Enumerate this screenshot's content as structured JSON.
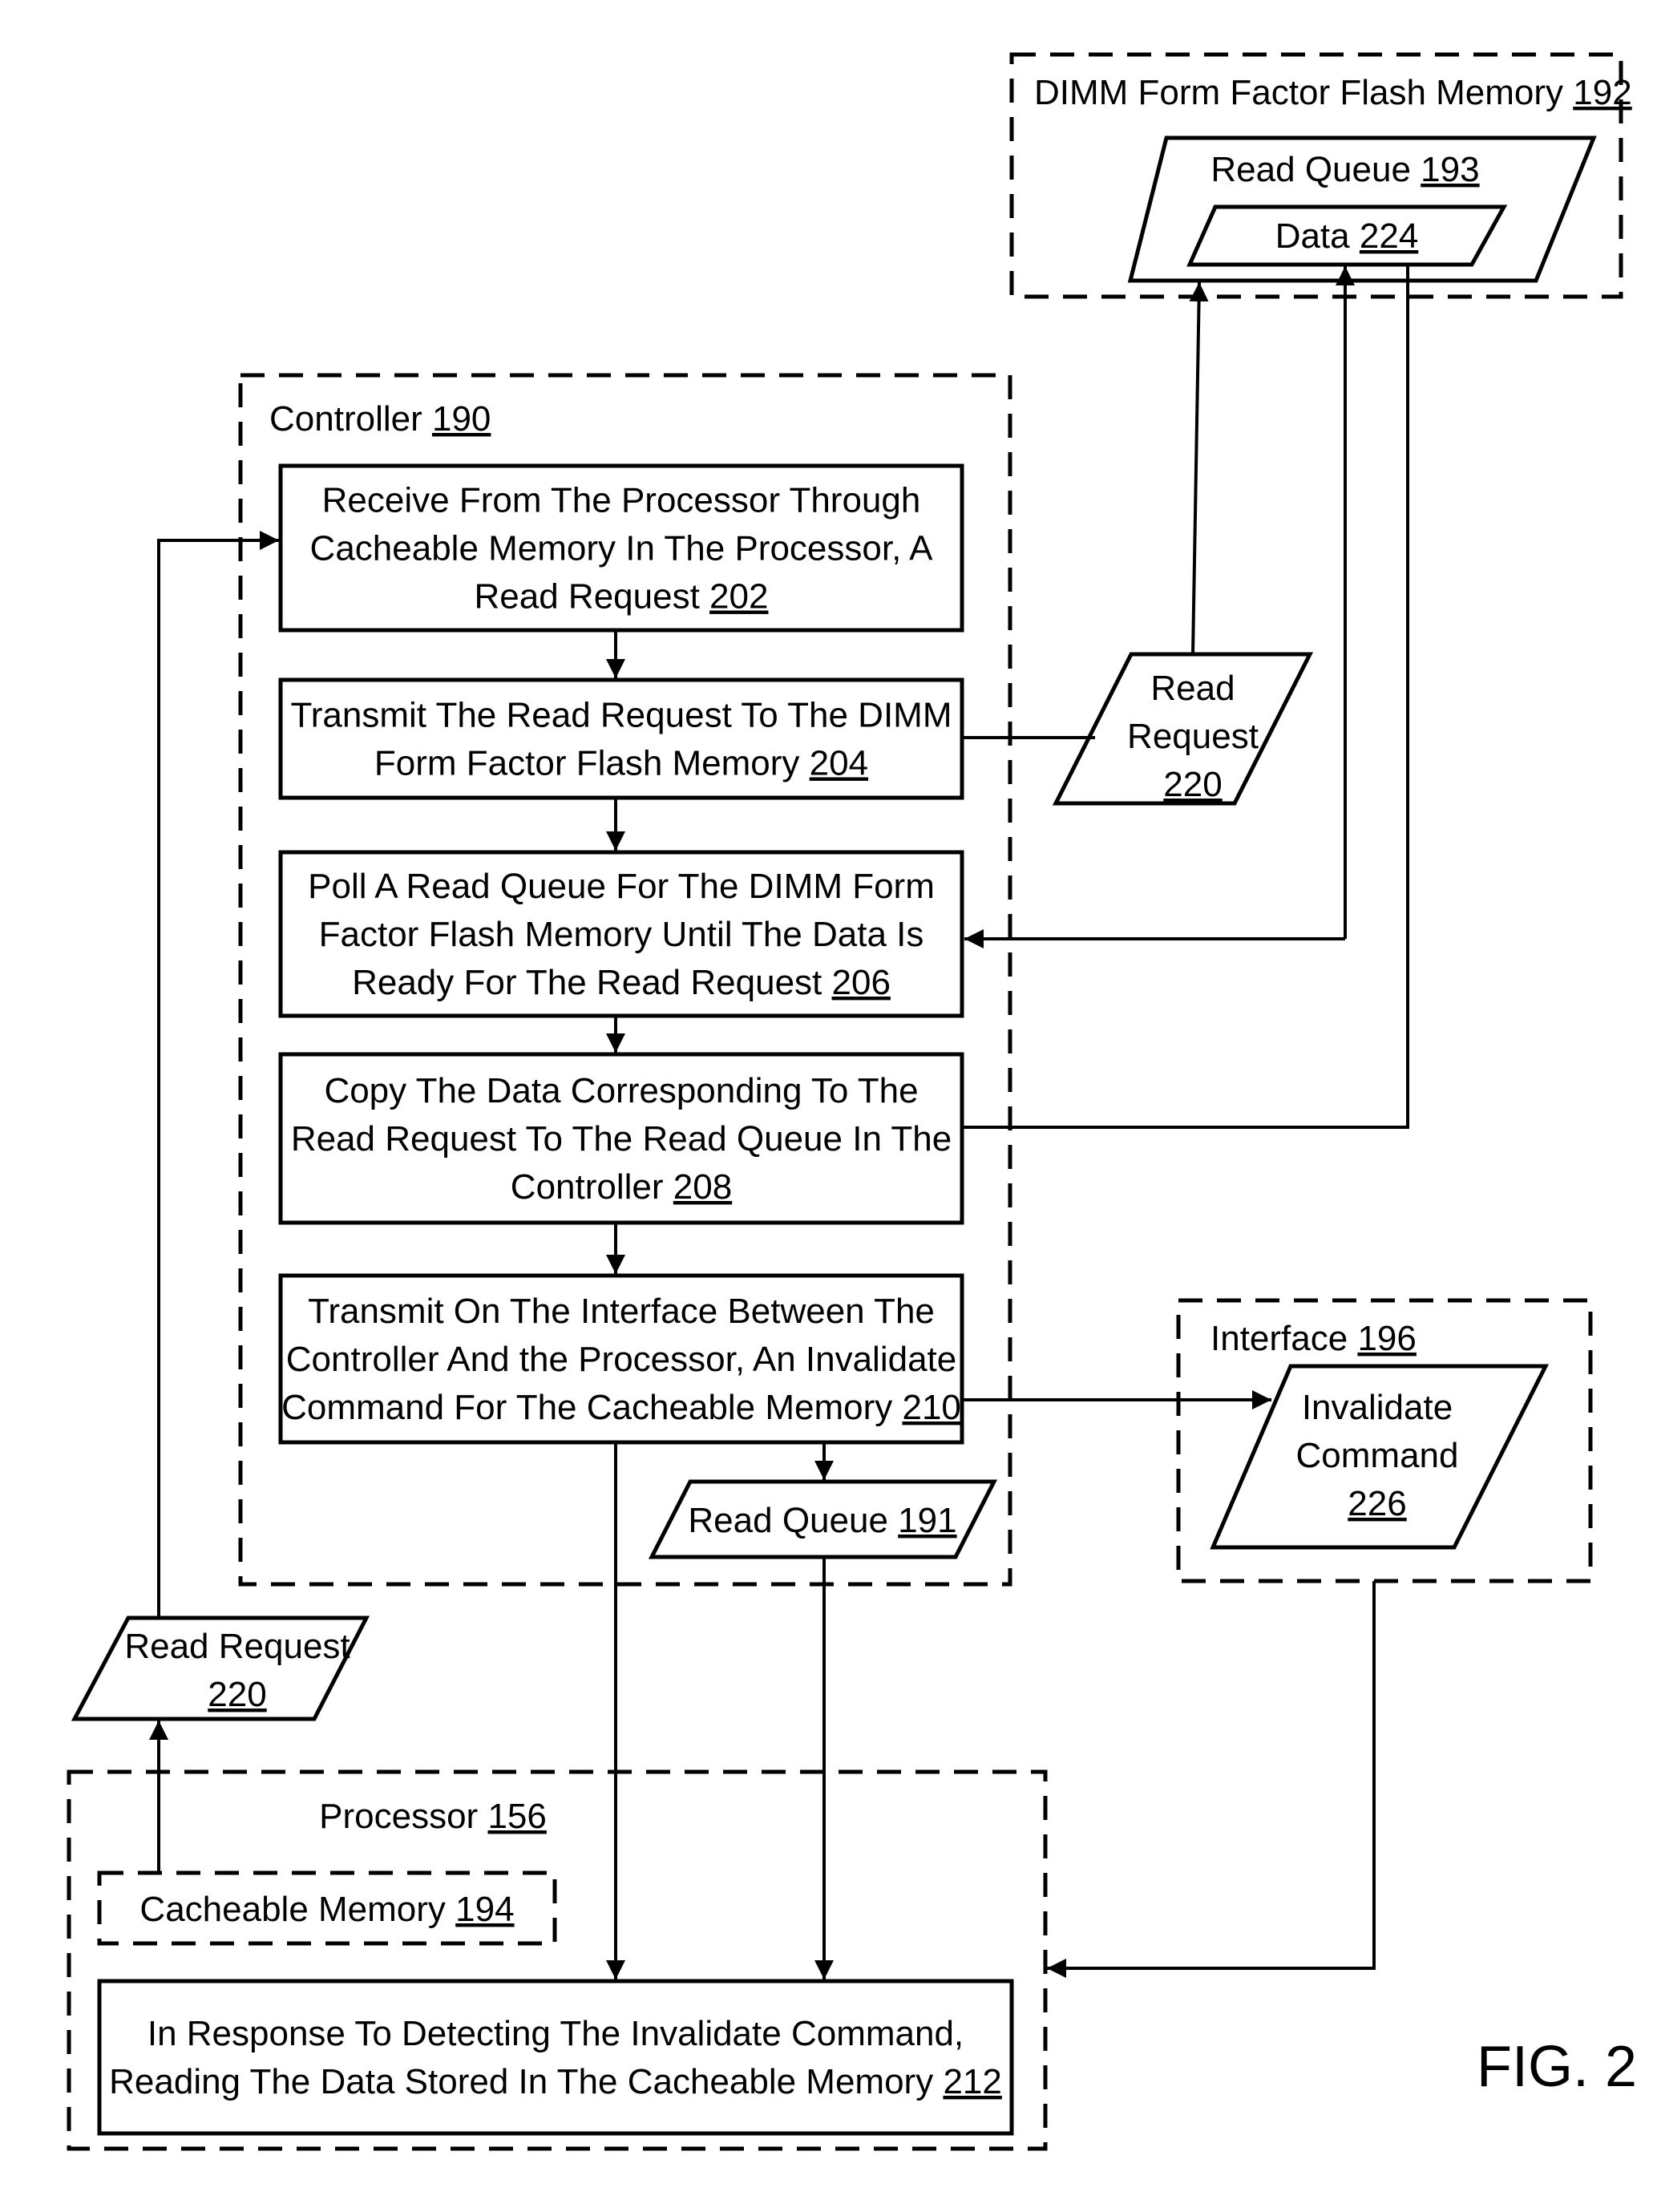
{
  "figure_label": "FIG. 2",
  "containers": {
    "dimm": {
      "label": "DIMM Form Factor Flash Memory",
      "ref": "192"
    },
    "controller": {
      "label": "Controller",
      "ref": "190"
    },
    "interface": {
      "label": "Interface",
      "ref": "196"
    },
    "processor": {
      "label": "Processor",
      "ref": "156"
    },
    "cacheable_memory": {
      "label": "Cacheable Memory",
      "ref": "194"
    }
  },
  "data_objects": {
    "read_queue_193": {
      "label": "Read Queue",
      "ref": "193"
    },
    "data_224": {
      "label": "Data",
      "ref": "224"
    },
    "read_request_right": {
      "lines": [
        "Read",
        "Request"
      ],
      "ref": "220"
    },
    "read_request_left": {
      "lines": [
        "Read Request"
      ],
      "ref": "220"
    },
    "read_queue_191": {
      "label": "Read Queue",
      "ref": "191"
    },
    "invalidate_command": {
      "lines": [
        "Invalidate",
        "Command"
      ],
      "ref": "226"
    }
  },
  "steps": [
    {
      "id": "202",
      "lines": [
        "Receive From The Processor Through",
        "Cacheable Memory In The Processor, A",
        "Read Request"
      ],
      "ref": "202"
    },
    {
      "id": "204",
      "lines": [
        "Transmit The Read Request To The DIMM",
        "Form Factor Flash Memory"
      ],
      "ref": "204"
    },
    {
      "id": "206",
      "lines": [
        "Poll A Read Queue For The DIMM Form",
        "Factor Flash Memory Until The Data Is",
        "Ready For The Read Request"
      ],
      "ref": "206"
    },
    {
      "id": "208",
      "lines": [
        "Copy The Data Corresponding To The",
        "Read Request To The Read Queue In The",
        "Controller"
      ],
      "ref": "208"
    },
    {
      "id": "210",
      "lines": [
        "Transmit On The Interface Between The",
        "Controller And the Processor, An Invalidate",
        "Command For The Cacheable Memory"
      ],
      "ref": "210"
    },
    {
      "id": "212",
      "lines": [
        "In Response To Detecting The Invalidate Command,",
        "Reading The Data Stored In The Cacheable Memory"
      ],
      "ref": "212"
    }
  ]
}
